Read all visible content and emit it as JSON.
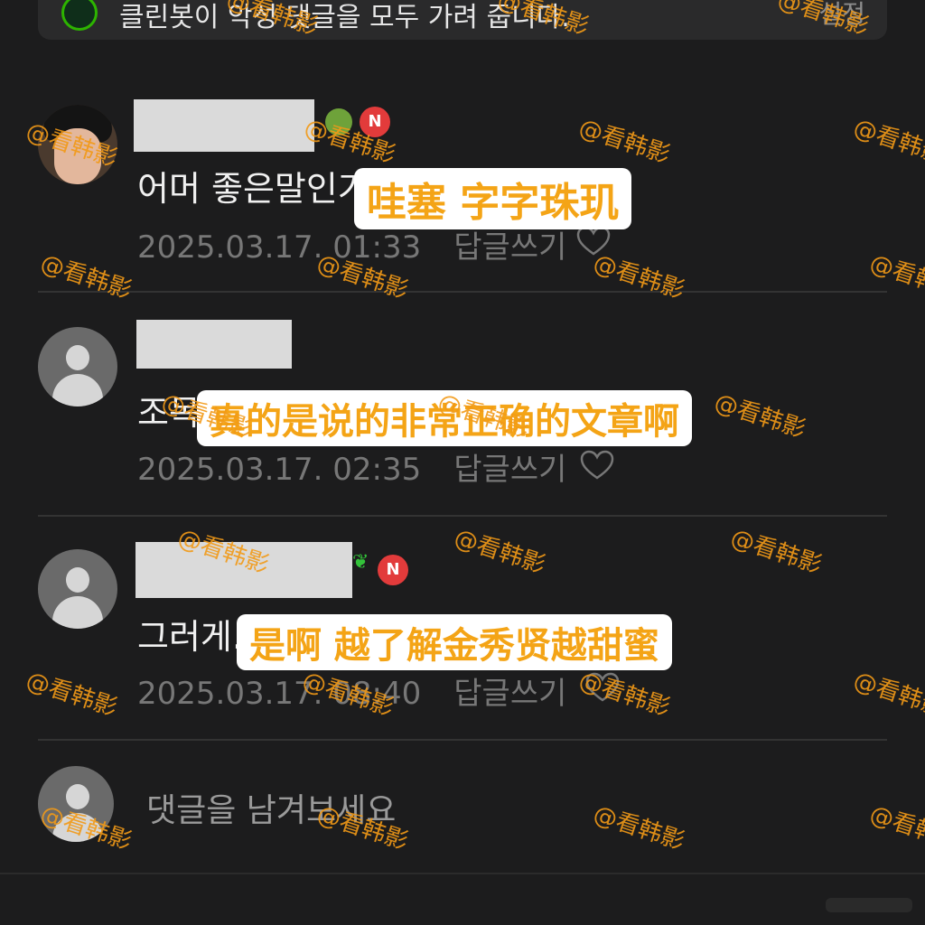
{
  "top": {
    "text": "클린봇이 악성 댓글을 모두 가려 줍니다.",
    "right": "설정"
  },
  "comments": [
    {
      "text": "어머 좋은말인가",
      "time": "2025.03.17. 01:33",
      "reply": "답글쓰기",
      "overlay": "哇塞 字字珠玑"
    },
    {
      "text": "조목",
      "time": "2025.03.17. 02:35",
      "reply": "답글쓰기",
      "overlay": "真的是说的非常正确的文章啊"
    },
    {
      "text": "그러게.",
      "time": "2025.03.17. 08:40",
      "reply": "답글쓰기",
      "overlay": "是啊 越了解金秀贤越甜蜜"
    }
  ],
  "badges": {
    "n": "N"
  },
  "input": {
    "placeholder": "댓글을 남겨보세요"
  },
  "watermark": "@看韩影",
  "colors": {
    "background": "#1c1c1d",
    "overlay_text": "#f4a416",
    "badge": "#e23b3b"
  }
}
